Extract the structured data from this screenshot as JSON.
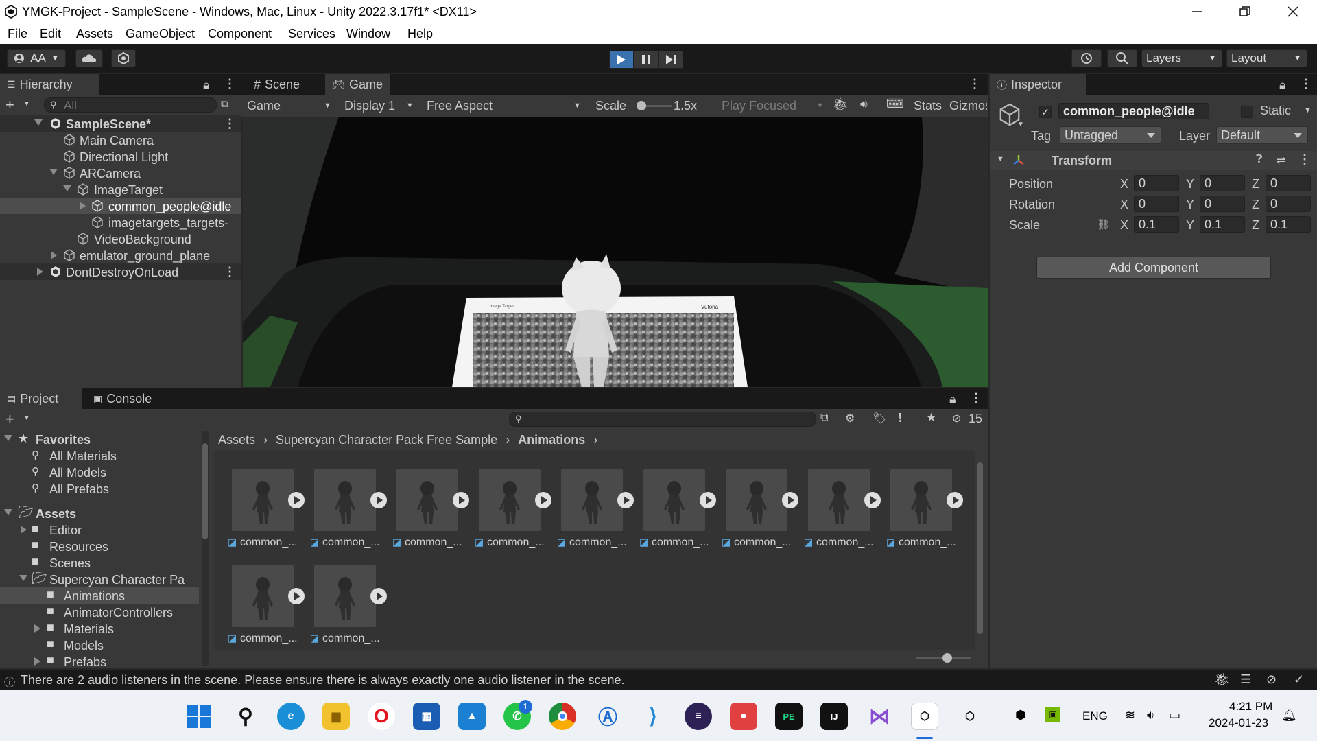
{
  "window": {
    "title": "YMGK-Project - SampleScene - Windows, Mac, Linux - Unity 2022.3.17f1* <DX11>"
  },
  "menu": [
    "File",
    "Edit",
    "Assets",
    "GameObject",
    "Component",
    "Services",
    "Window",
    "Help"
  ],
  "toolbar": {
    "account": "AA",
    "layers": "Layers",
    "layout": "Layout"
  },
  "hierarchy": {
    "tab": "Hierarchy",
    "search_placeholder": "All",
    "items": [
      {
        "label": "SampleScene*",
        "depth": 0,
        "expanded": true,
        "scene": true
      },
      {
        "label": "Main Camera",
        "depth": 1
      },
      {
        "label": "Directional Light",
        "depth": 1
      },
      {
        "label": "ARCamera",
        "depth": 1,
        "expanded": true
      },
      {
        "label": "ImageTarget",
        "depth": 2,
        "expanded": true
      },
      {
        "label": "common_people@idle",
        "depth": 3,
        "collapsed": true,
        "selected": true
      },
      {
        "label": "imagetargets_targets-",
        "depth": 3
      },
      {
        "label": "VideoBackground",
        "depth": 2
      },
      {
        "label": "emulator_ground_plane",
        "depth": 1,
        "collapsed": true
      },
      {
        "label": "DontDestroyOnLoad",
        "depth": 0,
        "collapsed": true,
        "scene": true
      }
    ]
  },
  "game": {
    "tabs": [
      "Scene",
      "Game"
    ],
    "mode": "Game",
    "display": "Display 1",
    "aspect": "Free Aspect",
    "scale_label": "Scale",
    "scale_value": "1.5x",
    "play_focused": "Play Focused",
    "stats": "Stats",
    "gizmos": "Gizmos"
  },
  "inspector": {
    "tab": "Inspector",
    "object_name": "common_people@idle",
    "static_label": "Static",
    "tag_label": "Tag",
    "tag_value": "Untagged",
    "layer_label": "Layer",
    "layer_value": "Default",
    "component": "Transform",
    "position": {
      "label": "Position",
      "x": "0",
      "y": "0",
      "z": "0"
    },
    "rotation": {
      "label": "Rotation",
      "x": "0",
      "y": "0",
      "z": "0"
    },
    "scale": {
      "label": "Scale",
      "x": "0.1",
      "y": "0.1",
      "z": "0.1"
    },
    "add_component": "Add Component"
  },
  "project": {
    "tabs": [
      "Project",
      "Console"
    ],
    "hidden_count": "15",
    "favorites": {
      "label": "Favorites",
      "items": [
        "All Materials",
        "All Models",
        "All Prefabs"
      ]
    },
    "assets": {
      "label": "Assets",
      "items": [
        "Editor",
        "Resources",
        "Scenes",
        "Supercyan Character Pa",
        "Animations",
        "AnimatorControllers",
        "Materials",
        "Models",
        "Prefabs"
      ]
    },
    "breadcrumb": [
      "Assets",
      "Supercyan Character Pack Free Sample",
      "Animations"
    ],
    "asset_label": "common_..."
  },
  "status": {
    "message": "There are 2 audio listeners in the scene. Please ensure there is always exactly one audio listener in the scene."
  },
  "taskbar": {
    "lang": "ENG",
    "time": "4:21 PM",
    "date": "2024-01-23",
    "whatsapp_badge": "1"
  },
  "colors": {
    "accent_blue": "#4c7fc7",
    "play_active": "#3a72b0",
    "selected_row": "#4d4d4d"
  }
}
